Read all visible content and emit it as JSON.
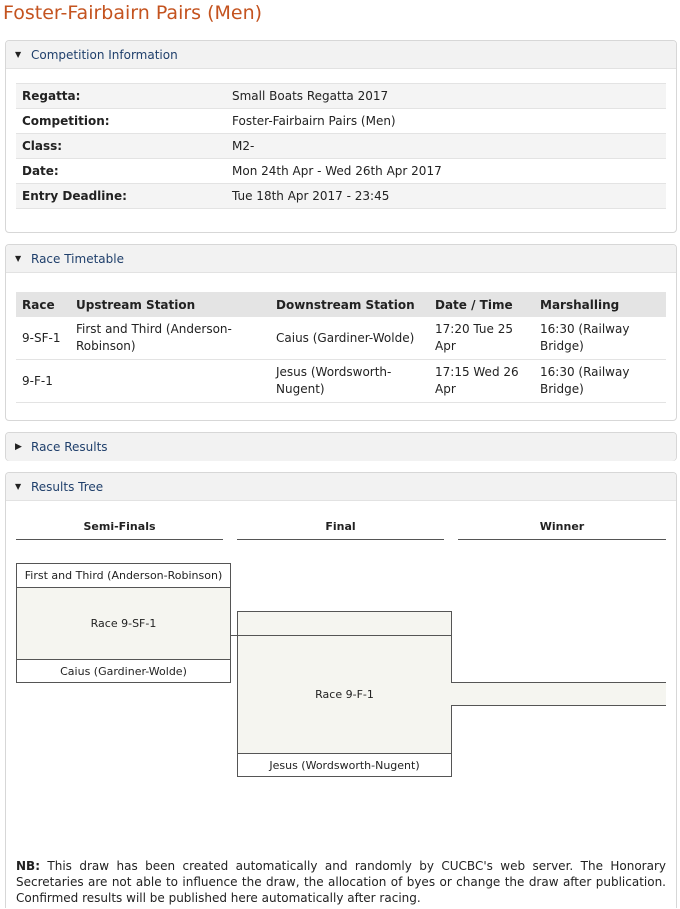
{
  "page_title": "Foster-Fairbairn Pairs (Men)",
  "competition_info": {
    "heading": "Competition Information",
    "rows": [
      {
        "key": "Regatta:",
        "value": "Small Boats Regatta 2017"
      },
      {
        "key": "Competition:",
        "value": "Foster-Fairbairn Pairs (Men)"
      },
      {
        "key": "Class:",
        "value": "M2-"
      },
      {
        "key": "Date:",
        "value": "Mon 24th Apr - Wed 26th Apr 2017"
      },
      {
        "key": "Entry Deadline:",
        "value": "Tue 18th Apr 2017 - 23:45"
      }
    ]
  },
  "race_timetable": {
    "heading": "Race Timetable",
    "columns": [
      "Race",
      "Upstream Station",
      "Downstream Station",
      "Date / Time",
      "Marshalling"
    ],
    "rows": [
      {
        "race": "9-SF-1",
        "upstream": "First and Third (Anderson-Robinson)",
        "downstream": "Caius (Gardiner-Wolde)",
        "datetime": "17:20 Tue 25 Apr",
        "marshalling": "16:30 (Railway Bridge)"
      },
      {
        "race": "9-F-1",
        "upstream": "",
        "downstream": "Jesus (Wordsworth-Nugent)",
        "datetime": "17:15 Wed 26 Apr",
        "marshalling": "16:30 (Railway Bridge)"
      }
    ]
  },
  "race_results": {
    "heading": "Race Results"
  },
  "results_tree": {
    "heading": "Results Tree",
    "columns": [
      "Semi-Finals",
      "Final",
      "Winner"
    ],
    "semi_final": {
      "top_crew": "First and Third (Anderson-Robinson)",
      "race_label": "Race 9-SF-1",
      "bottom_crew": "Caius (Gardiner-Wolde)"
    },
    "final": {
      "top_crew": "",
      "race_label": "Race 9-F-1",
      "bottom_crew": "Jesus (Wordsworth-Nugent)"
    },
    "winner": ""
  },
  "note": {
    "label": "NB:",
    "text": " This draw has been created automatically and randomly by CUCBC's web server. The Honorary Secretaries are not able to influence the draw, the allocation of byes or change the draw after publication. Confirmed results will be published here automatically after racing."
  }
}
